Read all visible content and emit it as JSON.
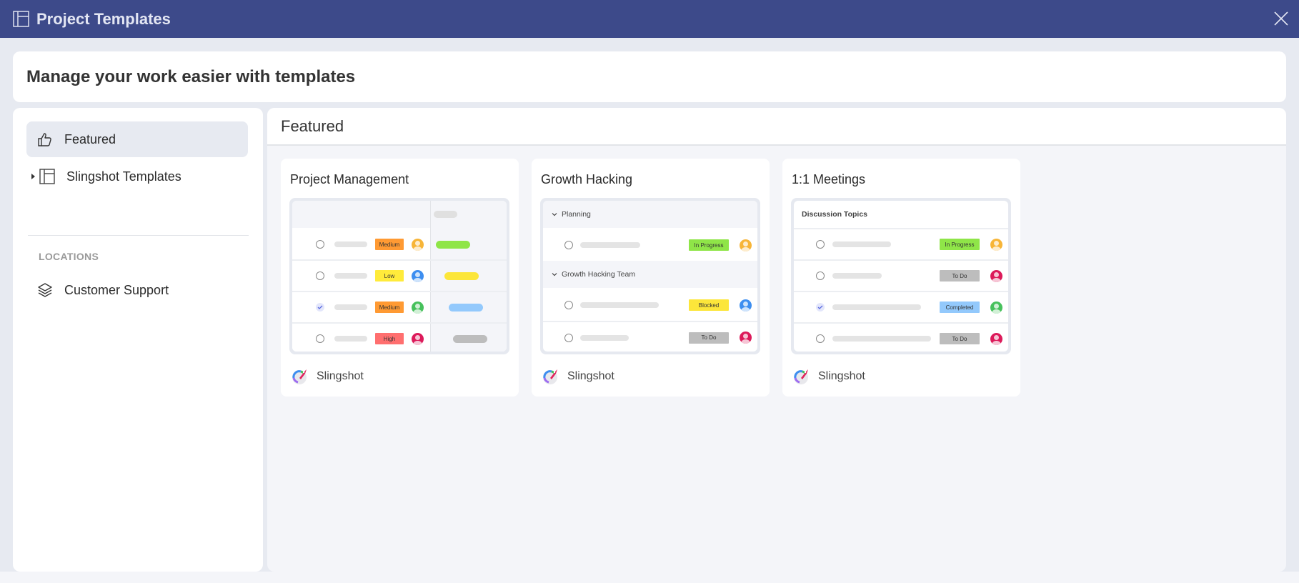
{
  "window": {
    "title": "Project Templates",
    "title_icon": "template-layout-icon",
    "close_icon": "close-icon",
    "accent_color": "#3d4a8a"
  },
  "banner": {
    "title": "Manage your work easier with templates"
  },
  "sidebar": {
    "items": [
      {
        "label": "Featured",
        "icon": "thumbs-up-icon",
        "active": true
      },
      {
        "label": "Slingshot Templates",
        "icon": "template-layout-icon",
        "expandable": true,
        "expanded": false
      }
    ],
    "section_label": "LOCATIONS",
    "locations": [
      {
        "label": "Customer Support",
        "icon": "layers-icon"
      }
    ]
  },
  "main": {
    "title": "Featured",
    "cards": [
      {
        "title": "Project Management",
        "brand": "Slingshot",
        "preview": {
          "rows": [
            {
              "checked": false,
              "priority": "Medium",
              "priority_color": "#ff9a33",
              "avatar_color": "#f7b538",
              "timeline_color": "#8fe548"
            },
            {
              "checked": false,
              "priority": "Low",
              "priority_color": "#ffeb3b",
              "avatar_color": "#3d8ef0",
              "timeline_color": "#fce63a"
            },
            {
              "checked": true,
              "priority": "Medium",
              "priority_color": "#ff9a33",
              "avatar_color": "#47c15c",
              "timeline_color": "#93c9fc"
            },
            {
              "checked": false,
              "priority": "High",
              "priority_color": "#ff6f6f",
              "avatar_color": "#dc1a5a",
              "timeline_color": "#bdbdbd"
            }
          ]
        }
      },
      {
        "title": "Growth Hacking",
        "brand": "Slingshot",
        "preview": {
          "groups": [
            {
              "name": "Planning",
              "rows": [
                {
                  "checked": false,
                  "status": "In Progress",
                  "status_color": "#8fe548",
                  "avatar_color": "#f7b538"
                }
              ]
            },
            {
              "name": "Growth Hacking Team",
              "rows": [
                {
                  "checked": false,
                  "status": "Blocked",
                  "status_color": "#fce63a",
                  "avatar_color": "#3d8ef0"
                },
                {
                  "checked": false,
                  "status": "To Do",
                  "status_color": "#bdbdbd",
                  "avatar_color": "#dc1a5a"
                }
              ]
            }
          ]
        }
      },
      {
        "title": "1:1 Meetings",
        "brand": "Slingshot",
        "preview": {
          "header": "Discussion Topics",
          "rows": [
            {
              "checked": false,
              "status": "In Progress",
              "status_color": "#8fe548",
              "avatar_color": "#f7b538"
            },
            {
              "checked": false,
              "status": "To Do",
              "status_color": "#bdbdbd",
              "avatar_color": "#dc1a5a"
            },
            {
              "checked": true,
              "status": "Completed",
              "status_color": "#93c9fc",
              "avatar_color": "#47c15c"
            },
            {
              "checked": false,
              "status": "To Do",
              "status_color": "#bdbdbd",
              "avatar_color": "#dc1a5a"
            }
          ]
        }
      }
    ]
  }
}
